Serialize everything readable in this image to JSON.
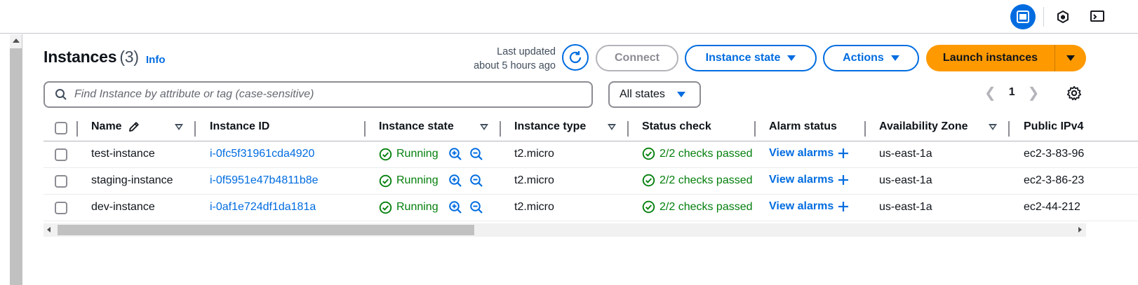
{
  "header": {
    "title": "Instances",
    "count": "(3)",
    "info_label": "Info",
    "last_updated_line1": "Last updated",
    "last_updated_line2": "about 5 hours ago"
  },
  "buttons": {
    "connect": "Connect",
    "instance_state": "Instance state",
    "actions": "Actions",
    "launch": "Launch instances"
  },
  "search": {
    "placeholder": "Find Instance by attribute or tag (case-sensitive)",
    "value": ""
  },
  "filter": {
    "states_label": "All states"
  },
  "pagination": {
    "current_page": "1"
  },
  "table": {
    "columns": [
      "Name",
      "Instance ID",
      "Instance state",
      "Instance type",
      "Status check",
      "Alarm status",
      "Availability Zone",
      "Public IPv4"
    ],
    "rows": [
      {
        "name": "test-instance",
        "id": "i-0fc5f31961cda4920",
        "state": "Running",
        "type": "t2.micro",
        "status": "2/2 checks passed",
        "alarm": "View alarms",
        "az": "us-east-1a",
        "ipv4": "ec2-3-83-96"
      },
      {
        "name": "staging-instance",
        "id": "i-0f5951e47b4811b8e",
        "state": "Running",
        "type": "t2.micro",
        "status": "2/2 checks passed",
        "alarm": "View alarms",
        "az": "us-east-1a",
        "ipv4": "ec2-3-86-23"
      },
      {
        "name": "dev-instance",
        "id": "i-0af1e724df1da181a",
        "state": "Running",
        "type": "t2.micro",
        "status": "2/2 checks passed",
        "alarm": "View alarms",
        "az": "us-east-1a",
        "ipv4": "ec2-44-212"
      }
    ]
  },
  "colors": {
    "accent": "#006ce0",
    "primary_button": "#ff9900",
    "success": "#037f0c"
  },
  "icons": [
    "panel-icon",
    "hexagon-icon",
    "terminal-icon",
    "refresh-icon",
    "search-icon",
    "gear-icon",
    "pencil-icon",
    "zoom-in-icon",
    "zoom-out-icon",
    "check-circle-icon",
    "plus-icon"
  ]
}
